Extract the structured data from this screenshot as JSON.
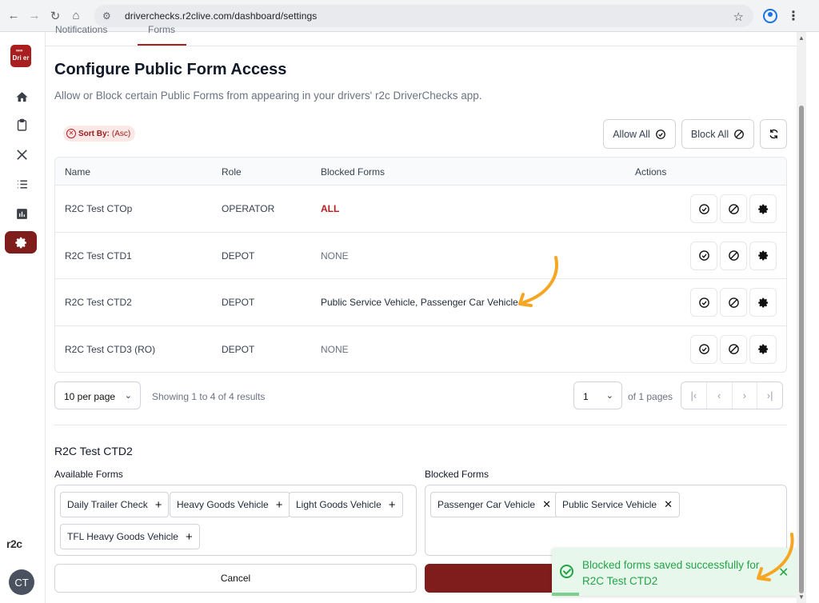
{
  "browser": {
    "url": "driverchecks.r2clive.com/dashboard/settings"
  },
  "sidebar": {
    "logo_text": "Dri er",
    "logo_mini": "∞∞",
    "items": [
      "home-icon",
      "clipboard-icon",
      "tools-icon",
      "list-icon",
      "chart-icon",
      "settings-icon"
    ],
    "active_item": "settings-icon",
    "brand_mark": "r2c",
    "avatar_initials": "CT"
  },
  "tabs": {
    "items": [
      "Notifications",
      "Forms"
    ],
    "active": "Forms"
  },
  "header": {
    "title": "Configure Public Form Access",
    "subtitle": "Allow or Block certain Public Forms from appearing in your drivers' r2c DriverChecks app."
  },
  "toolbar": {
    "sort_label": "Sort By:",
    "sort_value": "(Asc)",
    "allow_all_label": "Allow All",
    "block_all_label": "Block All"
  },
  "table": {
    "columns": [
      "Name",
      "Role",
      "Blocked Forms",
      "Actions"
    ],
    "rows": [
      {
        "name": "R2C Test CTOp",
        "role": "OPERATOR",
        "blocked": "ALL"
      },
      {
        "name": "R2C Test CTD1",
        "role": "DEPOT",
        "blocked": "NONE"
      },
      {
        "name": "R2C Test CTD2",
        "role": "DEPOT",
        "blocked": "Public Service Vehicle, Passenger Car Vehicle"
      },
      {
        "name": "R2C Test CTD3 (RO)",
        "role": "DEPOT",
        "blocked": "NONE"
      }
    ]
  },
  "pagination": {
    "per_page_label": "10 per page",
    "showing": "Showing 1 to 4 of 4 results",
    "current_page": "1",
    "of_pages": "of 1 pages"
  },
  "editor": {
    "selected_driver": "R2C Test CTD2",
    "available_label": "Available Forms",
    "blocked_label": "Blocked Forms",
    "available_forms": [
      "Daily Trailer Check",
      "Heavy Goods Vehicle",
      "Light Goods Vehicle",
      "TFL Heavy Goods Vehicle"
    ],
    "blocked_forms": [
      "Passenger Car Vehicle",
      "Public Service Vehicle"
    ],
    "cancel_label": "Cancel"
  },
  "toast": {
    "message": "Blocked forms saved successfully for R2C Test CTD2",
    "progress": 0.11
  },
  "colors": {
    "brand": "#7f1d1d",
    "success": "#22a447",
    "annotation_arrow": "#f5a623"
  }
}
